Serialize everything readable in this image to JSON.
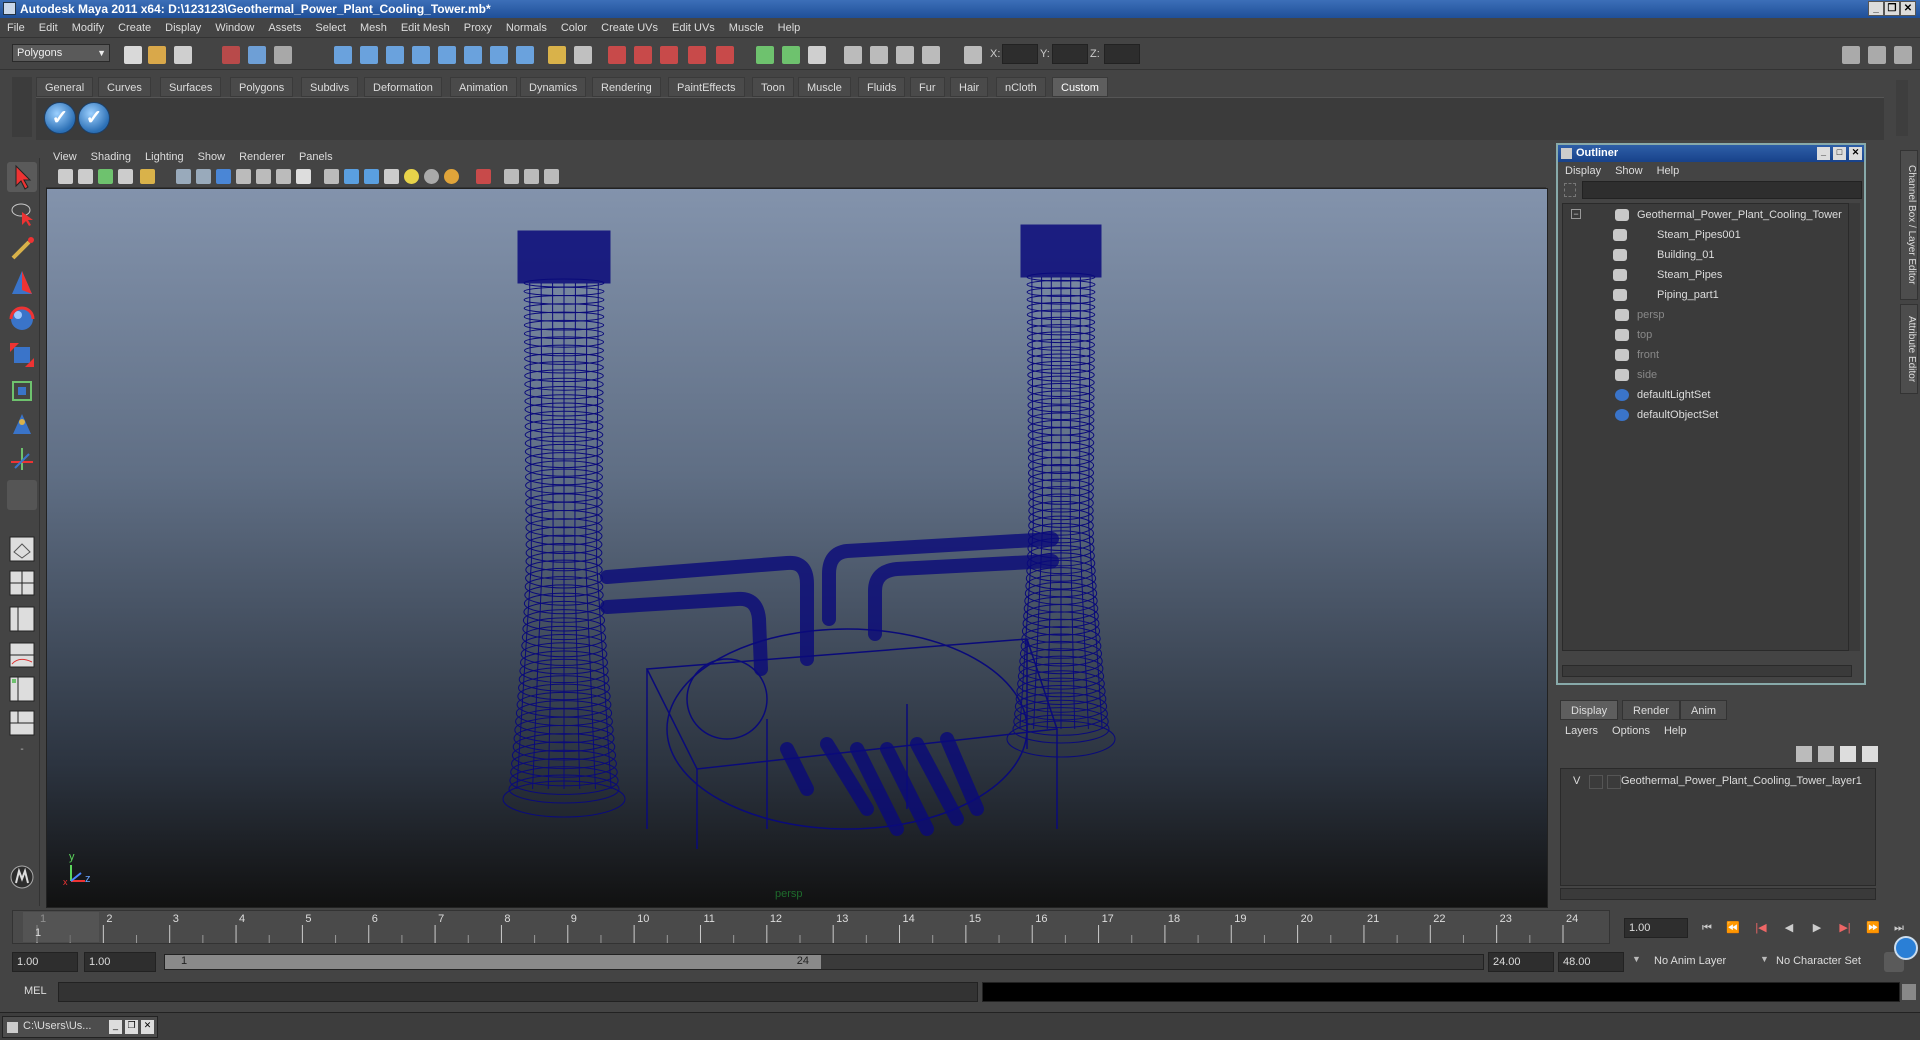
{
  "window": {
    "title": "Autodesk Maya 2011 x64: D:\\123123\\Geothermal_Power_Plant_Cooling_Tower.mb*"
  },
  "menubar": [
    "File",
    "Edit",
    "Modify",
    "Create",
    "Display",
    "Window",
    "Assets",
    "Select",
    "Mesh",
    "Edit Mesh",
    "Proxy",
    "Normals",
    "Color",
    "Create UVs",
    "Edit UVs",
    "Muscle",
    "Help"
  ],
  "statusline": {
    "mode": "Polygons",
    "x_label": "X:",
    "y_label": "Y:",
    "z_label": "Z:"
  },
  "shelf": {
    "tabs": [
      "General",
      "Curves",
      "Surfaces",
      "Polygons",
      "Subdivs",
      "Deformation",
      "Animation",
      "Dynamics",
      "Rendering",
      "PaintEffects",
      "Toon",
      "Muscle",
      "Fluids",
      "Fur",
      "Hair",
      "nCloth",
      "Custom"
    ],
    "active_tab": "Custom",
    "buttons": [
      "✓",
      "✓"
    ]
  },
  "viewport": {
    "menu": [
      "View",
      "Shading",
      "Lighting",
      "Show",
      "Renderer",
      "Panels"
    ],
    "camera_label": "persp",
    "axis_x": "x",
    "axis_y": "y",
    "axis_z": "z",
    "wire_color": "#0a0a7a"
  },
  "outliner": {
    "title": "Outliner",
    "menu": [
      "Display",
      "Show",
      "Help"
    ],
    "items": [
      {
        "label": "Geothermal_Power_Plant_Cooling_Tower",
        "indent": 0,
        "dim": false
      },
      {
        "label": "Steam_Pipes001",
        "indent": 1,
        "dim": false
      },
      {
        "label": "Building_01",
        "indent": 1,
        "dim": false
      },
      {
        "label": "Steam_Pipes",
        "indent": 1,
        "dim": false
      },
      {
        "label": "Piping_part1",
        "indent": 1,
        "dim": false
      },
      {
        "label": "persp",
        "indent": 0,
        "dim": true
      },
      {
        "label": "top",
        "indent": 0,
        "dim": true
      },
      {
        "label": "front",
        "indent": 0,
        "dim": true
      },
      {
        "label": "side",
        "indent": 0,
        "dim": true
      },
      {
        "label": "defaultLightSet",
        "indent": 0,
        "dim": false
      },
      {
        "label": "defaultObjectSet",
        "indent": 0,
        "dim": false
      }
    ]
  },
  "sidetabs": [
    "Channel Box / Layer Editor",
    "Attribute Editor"
  ],
  "layers": {
    "tabs": [
      "Display",
      "Render",
      "Anim"
    ],
    "active_tab": "Display",
    "menu": [
      "Layers",
      "Options",
      "Help"
    ],
    "rows": [
      {
        "visible": "V",
        "name": "Geothermal_Power_Plant_Cooling_Tower_layer1"
      }
    ]
  },
  "timeslider": {
    "ticks": [
      "1",
      "2",
      "3",
      "4",
      "5",
      "6",
      "7",
      "8",
      "9",
      "10",
      "11",
      "12",
      "13",
      "14",
      "15",
      "16",
      "17",
      "18",
      "19",
      "20",
      "21",
      "22",
      "23",
      "24"
    ],
    "current_frame": "1",
    "current_time": "1.00"
  },
  "rangebar": {
    "start_time": "1.00",
    "playback_start": "1.00",
    "range_start": "1",
    "range_end": "24",
    "playback_end": "24.00",
    "end_time": "48.00",
    "anim_layer": "No Anim Layer",
    "character_set": "No Character Set"
  },
  "cmdline": {
    "label": "MEL"
  },
  "taskbar": {
    "item": "C:\\Users\\Us..."
  }
}
